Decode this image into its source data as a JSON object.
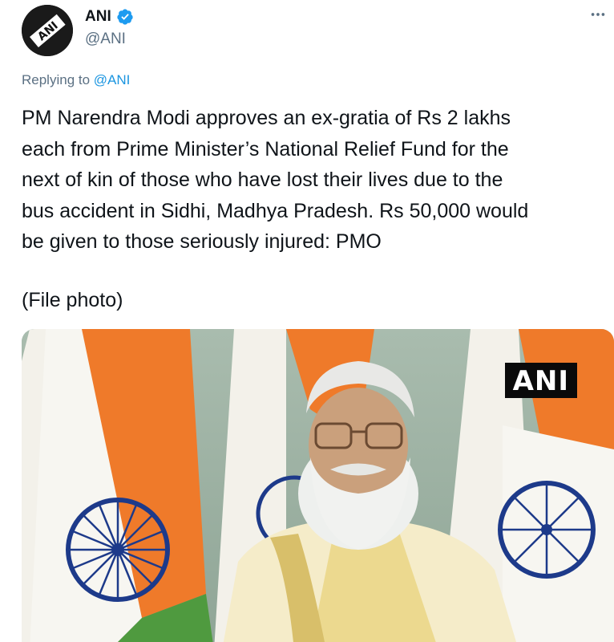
{
  "account": {
    "name": "ANI",
    "handle": "@ANI",
    "verified": true,
    "avatar_icon": "ani-logo-icon"
  },
  "reply": {
    "prefix": "Replying to ",
    "mention": "@ANI"
  },
  "tweet": {
    "text": "PM Narendra Modi approves an ex-gratia of Rs 2 lakhs\neach from Prime Minister’s National Relief Fund for the\nnext of kin of those who have lost their lives due to the\nbus accident in Sidhi, Madhya Pradesh. Rs 50,000 would\nbe given to those seriously injured: PMO",
    "caption": "(File photo)"
  },
  "media": {
    "watermark": "ANI",
    "description_icon": "photo-icon"
  },
  "colors": {
    "verified_blue": "#1d9bf0",
    "link_blue": "#1b95e0",
    "secondary_text": "#5b7083"
  },
  "icons": {
    "more": "more-dots-icon",
    "verified": "verified-badge-icon"
  }
}
